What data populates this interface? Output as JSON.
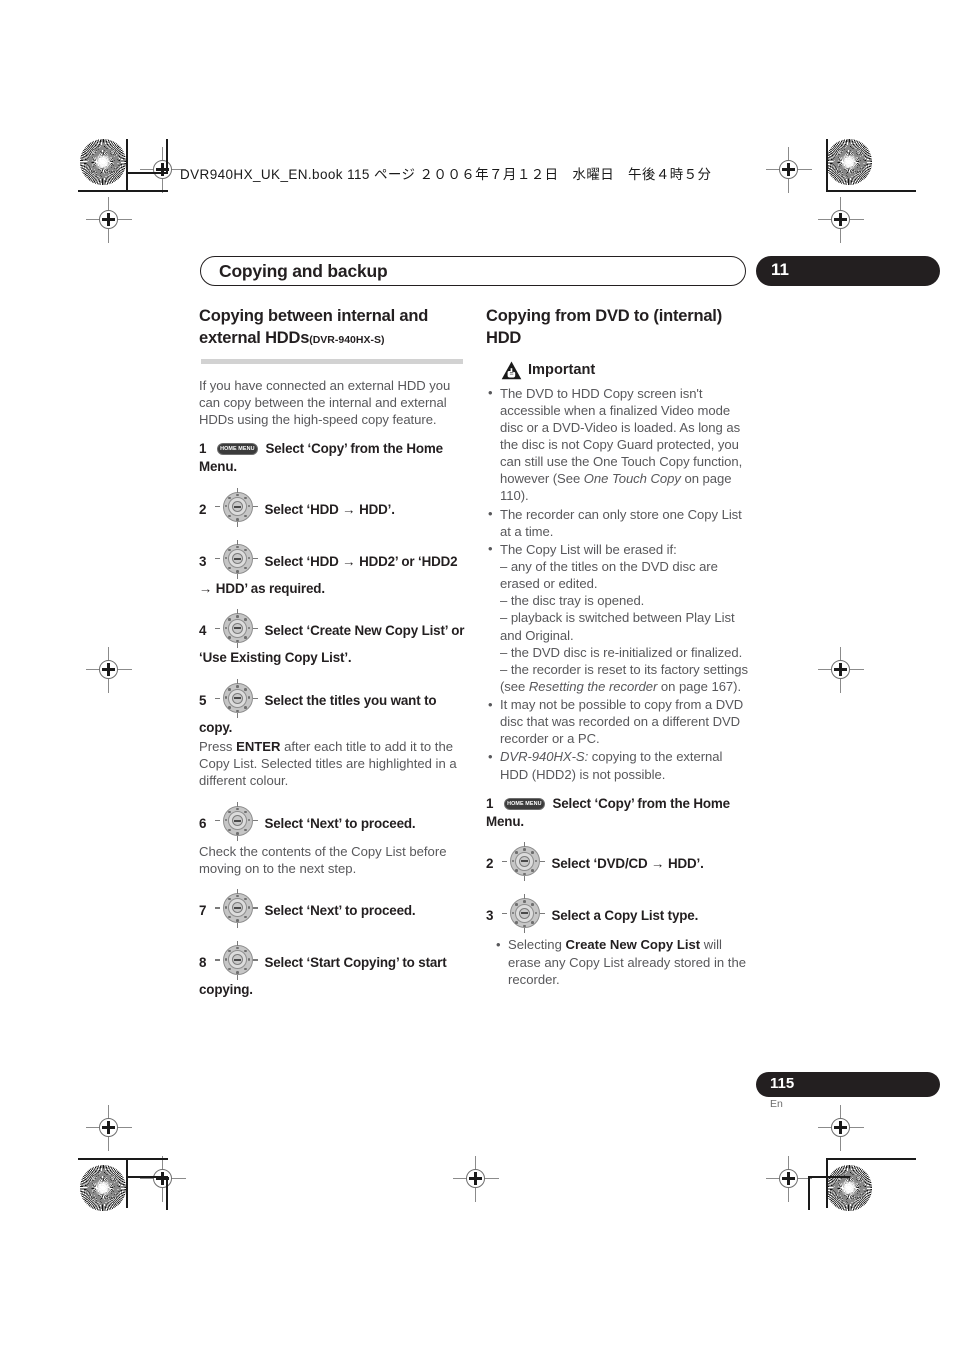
{
  "header": {
    "book_line": "DVR940HX_UK_EN.book  115 ページ  ２００６年７月１２日　水曜日　午後４時５分"
  },
  "chapter": {
    "title": "Copying and backup",
    "number": "11"
  },
  "left_column": {
    "heading": "Copying between internal and external HDDs",
    "heading_model": "(DVR-940HX-S)",
    "intro": "If you have connected an external HDD you can copy between the internal and external HDDs using the high-speed copy feature.",
    "steps": [
      {
        "num": "1",
        "icon": "home-menu-icon",
        "icon_label": "HOME MENU",
        "text": "Select ‘Copy’ from the Home Menu.",
        "sub": ""
      },
      {
        "num": "2",
        "icon": "nav-pad-icon",
        "text": "Select ‘HDD → HDD’.",
        "sub": ""
      },
      {
        "num": "3",
        "icon": "nav-pad-icon",
        "text": "Select ‘HDD → HDD2’ or ‘HDD2 → HDD’ as required.",
        "sub": ""
      },
      {
        "num": "4",
        "icon": "nav-pad-icon",
        "text": "Select ‘Create New Copy List’ or ‘Use Existing Copy List’.",
        "sub": ""
      },
      {
        "num": "5",
        "icon": "nav-pad-icon",
        "text": "Select the titles you want to copy.",
        "sub_pre": "Press ",
        "sub_bold": "ENTER",
        "sub_post": " after each title to add it to the Copy List. Selected titles are highlighted in a different colour."
      },
      {
        "num": "6",
        "icon": "nav-pad-icon",
        "text": "Select ‘Next’ to proceed.",
        "sub": "Check the contents of the Copy List before moving on to the next step."
      },
      {
        "num": "7",
        "icon": "nav-pad-icon",
        "text": "Select ‘Next’ to proceed.",
        "sub": ""
      },
      {
        "num": "8",
        "icon": "nav-pad-icon",
        "text": "Select ‘Start Copying’ to start copying.",
        "sub": ""
      }
    ]
  },
  "right_column": {
    "heading": "Copying from DVD to (internal) HDD",
    "important": {
      "icon": "warning-triangle-icon",
      "title": "Important",
      "bullets": [
        {
          "parts": [
            {
              "style": "normal",
              "text": "The DVD to HDD Copy screen isn't accessible when a finalized Video mode disc or a DVD-Video is loaded. As long as the disc is not Copy Guard protected, you can still use the One Touch Copy function, however (See "
            },
            {
              "style": "italic",
              "text": "One Touch Copy"
            },
            {
              "style": "normal",
              "text": " on page 110)."
            }
          ]
        },
        {
          "parts": [
            {
              "style": "normal",
              "text": "The recorder can only store one Copy List at a time."
            }
          ]
        },
        {
          "parts": [
            {
              "style": "normal",
              "text": "The Copy List will be erased if:"
            }
          ],
          "dashes": [
            {
              "parts": [
                {
                  "style": "normal",
                  "text": "– any of the titles on the DVD disc are erased or edited."
                }
              ]
            },
            {
              "parts": [
                {
                  "style": "normal",
                  "text": "– the disc tray is opened."
                }
              ]
            },
            {
              "parts": [
                {
                  "style": "normal",
                  "text": "– playback is switched between Play List and Original."
                }
              ]
            },
            {
              "parts": [
                {
                  "style": "normal",
                  "text": "– the DVD disc is re-initialized or finalized."
                }
              ]
            },
            {
              "parts": [
                {
                  "style": "normal",
                  "text": "– the recorder is reset to its factory settings (see "
                },
                {
                  "style": "italic",
                  "text": "Resetting the recorder"
                },
                {
                  "style": "normal",
                  "text": " on page 167)."
                }
              ]
            }
          ]
        },
        {
          "parts": [
            {
              "style": "normal",
              "text": "It may not be possible to copy from a DVD disc that was recorded on a different DVD recorder or a PC."
            }
          ]
        },
        {
          "parts": [
            {
              "style": "italic",
              "text": "DVR-940HX-S:"
            },
            {
              "style": "normal",
              "text": " copying to the external HDD (HDD2) is not possible."
            }
          ]
        }
      ]
    },
    "steps": [
      {
        "num": "1",
        "icon": "home-menu-icon",
        "icon_label": "HOME MENU",
        "text": "Select ‘Copy’ from the Home Menu.",
        "sub": ""
      },
      {
        "num": "2",
        "icon": "nav-pad-icon",
        "text": "Select ‘DVD/CD → HDD’.",
        "sub": ""
      },
      {
        "num": "3",
        "icon": "nav-pad-icon",
        "text": "Select a Copy List type.",
        "sub_bullets": [
          {
            "parts": [
              {
                "style": "normal",
                "text": "Selecting "
              },
              {
                "style": "bold",
                "text": "Create New Copy List"
              },
              {
                "style": "normal",
                "text": " will erase any Copy List already stored in the recorder."
              }
            ]
          }
        ]
      }
    ]
  },
  "footer": {
    "page_number": "115",
    "language": "En"
  },
  "colors": {
    "ink": "#231f20",
    "body_text": "#58585b",
    "rule": "#d2d2d2",
    "icon_gray": "#c6c6c6"
  }
}
